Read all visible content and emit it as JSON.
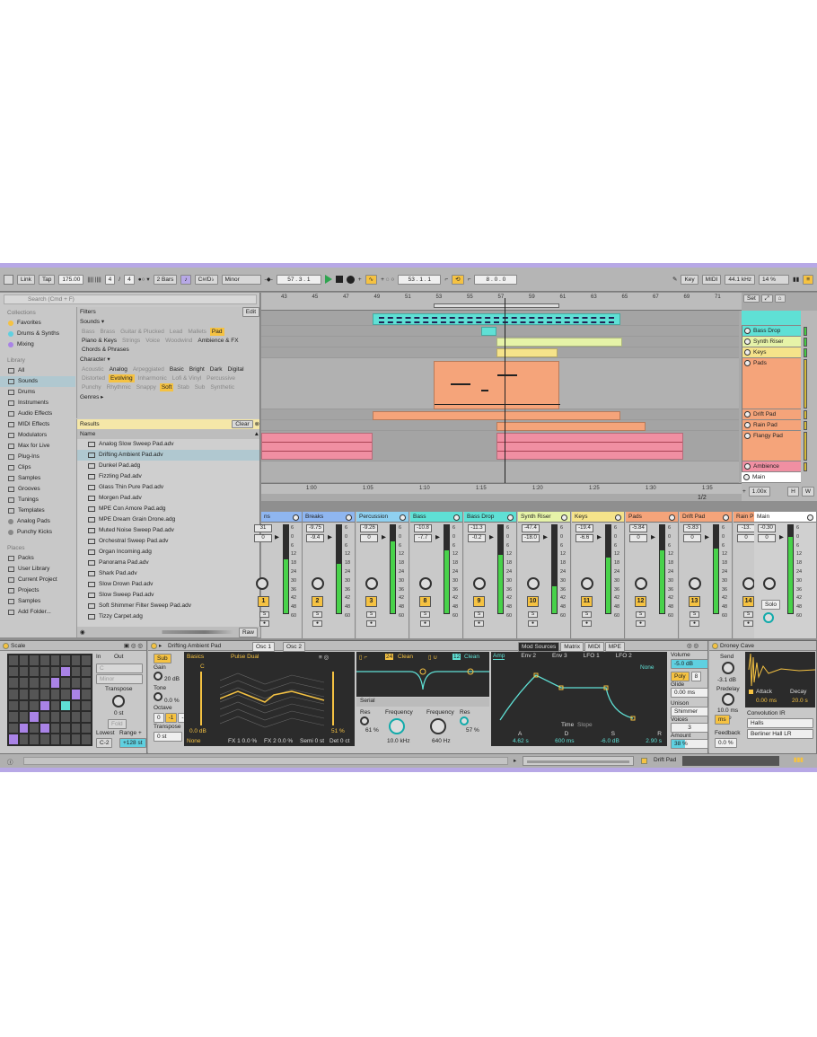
{
  "transport": {
    "link": "Link",
    "tap": "Tap",
    "tempo": "175.00",
    "signature_num": "4",
    "signature_den": "4",
    "quantize": "2 Bars",
    "key": "C#/D♭",
    "scale": "Minor",
    "position": "57 .  3 .  1",
    "loop_start": "53 .  1 .  1",
    "loop_length": "8 .  0 .  0",
    "key_btn": "Key",
    "midi_btn": "MIDI",
    "sample_rate": "44.1 kHz",
    "cpu": "14 %"
  },
  "browser": {
    "search_placeholder": "Search (Cmd + F)",
    "collections_header": "Collections",
    "collections": [
      {
        "label": "Favorites",
        "color": "#f5c242"
      },
      {
        "label": "Drums & Synths",
        "color": "#5fd0e0"
      },
      {
        "label": "Mixing",
        "color": "#a983e6"
      }
    ],
    "library_header": "Library",
    "library": [
      "All",
      "Sounds",
      "Drums",
      "Instruments",
      "Audio Effects",
      "MIDI Effects",
      "Modulators",
      "Max for Live",
      "Plug-Ins",
      "Clips",
      "Samples",
      "Grooves",
      "Tunings",
      "Templates",
      "Analog Pads",
      "Punchy Kicks"
    ],
    "places_header": "Places",
    "places": [
      "Packs",
      "User Library",
      "Current Project",
      "Projects",
      "Samples",
      "Add Folder..."
    ],
    "filters_label": "Filters",
    "edit": "Edit",
    "sounds_label": "Sounds ▾",
    "sounds_tags": [
      "Bass",
      "Brass",
      "Guitar & Plucked",
      "Lead",
      "Mallets",
      "Pad",
      "Piano & Keys",
      "Strings",
      "Voice",
      "Woodwind",
      "Ambience & FX",
      "Chords & Phrases"
    ],
    "character_label": "Character ▾",
    "character_tags": [
      "Acoustic",
      "Analog",
      "Arpeggiated",
      "Basic",
      "Bright",
      "Dark",
      "Digital",
      "Distorted",
      "Evolving",
      "Inharmonic",
      "Lofi & Vinyl",
      "Percussive",
      "Punchy",
      "Rhythmic",
      "Snappy",
      "Soft",
      "Stab",
      "Sub",
      "Synthetic"
    ],
    "genres_label": "Genres ▸",
    "results_label": "Results",
    "clear": "Clear",
    "name_col": "Name",
    "results": [
      "Analog Slow Sweep Pad.adv",
      "Drifting Ambient Pad.adv",
      "Dunkel Pad.adg",
      "Fizzling Pad.adv",
      "Glass Thin Pure Pad.adv",
      "Morgen Pad.adv",
      "MPE Con Amore Pad.adg",
      "MPE Dream Grain Drone.adg",
      "Muted Noise Sweep Pad.adv",
      "Orchestral Sweep Pad.adv",
      "Organ Incoming.adg",
      "Panorama Pad.adv",
      "Shark Pad.adv",
      "Slow Drown Pad.adv",
      "Slow Sweep Pad.adv",
      "Soft Shimmer Filter Sweep Pad.adv",
      "Tizzy Carpet.adg"
    ],
    "raw": "Raw"
  },
  "arrangement": {
    "bars": [
      "43",
      "45",
      "47",
      "49",
      "51",
      "53",
      "55",
      "57",
      "59",
      "61",
      "63",
      "65",
      "67",
      "69",
      "71"
    ],
    "times": [
      "1:00",
      "1:05",
      "1:10",
      "1:15",
      "1:20",
      "1:25",
      "1:30",
      "1:35"
    ],
    "set": "Set",
    "zoom": "1.00x",
    "fraction": "1/2",
    "h": "H",
    "w": "W",
    "tracks": [
      {
        "name": "Bass Drop",
        "color": "#5fe0d5"
      },
      {
        "name": "Synth Riser",
        "color": "#e6f3a8"
      },
      {
        "name": "Keys",
        "color": "#f5e38a"
      },
      {
        "name": "Pads",
        "color": "#f5a47a"
      },
      {
        "name": "Drift Pad",
        "color": "#f5a47a"
      },
      {
        "name": "Rain Pad",
        "color": "#f5a47a"
      },
      {
        "name": "Flangy Pad",
        "color": "#f5a47a"
      },
      {
        "name": "Ambience",
        "color": "#f08fa2"
      },
      {
        "name": "Main",
        "color": "#ffffff"
      }
    ]
  },
  "mixer": [
    {
      "name": "ns",
      "color": "#8fb6f0",
      "vol": "31",
      "pan": "0",
      "num": "1"
    },
    {
      "name": "Breaks",
      "color": "#8fb6f0",
      "vol": "-9.75",
      "pan": "-9.4",
      "num": "2"
    },
    {
      "name": "Percussion",
      "color": "#8fd0f0",
      "vol": "-9.26",
      "pan": "0",
      "num": "3"
    },
    {
      "name": "Bass",
      "color": "#5fe0d5",
      "vol": "-10.8",
      "pan": "-7.7",
      "num": "8"
    },
    {
      "name": "Bass Drop",
      "color": "#5fe0d5",
      "vol": "-11.3",
      "pan": "-0.2",
      "num": "9"
    },
    {
      "name": "Synth Riser",
      "color": "#e6f3a8",
      "vol": "-47.4",
      "pan": "-18.0",
      "num": "10"
    },
    {
      "name": "Keys",
      "color": "#f5e38a",
      "vol": "-19.4",
      "pan": "-6.6",
      "num": "11"
    },
    {
      "name": "Pads",
      "color": "#f5a47a",
      "vol": "-5.84",
      "pan": "0",
      "num": "12"
    },
    {
      "name": "Drift Pad",
      "color": "#f5a47a",
      "vol": "-5.83",
      "pan": "0",
      "num": "13"
    },
    {
      "name": "Rain P",
      "color": "#f5a47a",
      "vol": "-13.",
      "pan": "0",
      "num": "14"
    },
    {
      "name": "Main",
      "color": "#ffffff",
      "vol": "-0.30",
      "pan": "0",
      "num": ""
    }
  ],
  "mixer_scale": [
    "6",
    "0",
    "6",
    "12",
    "18",
    "24",
    "30",
    "36",
    "42",
    "48",
    "60"
  ],
  "mixer_solo": "Solo",
  "scale_device": {
    "title": "Scale",
    "in": "In",
    "out": "Out",
    "root_placeholder": "C",
    "mode_placeholder": "Minor",
    "transpose_label": "Transpose",
    "transpose": "0 st",
    "fold": "Fold",
    "lowest_label": "Lowest",
    "range_label": "Range +",
    "lowest": "C-2",
    "range": "+128 st"
  },
  "drift": {
    "title": "Drifting Ambient Pad",
    "osc1": "Osc 1",
    "osc2": "Osc 2",
    "sub": "Sub",
    "gain_label": "Gain",
    "gain": "20 dB",
    "tone_label": "Tone",
    "tone": "0.0 %",
    "octave_label": "Octave",
    "octaves": [
      "0",
      "-1",
      "-2"
    ],
    "transpose_label": "Transpose",
    "transpose": "0 st",
    "basics": "Basics",
    "wave": "Pulse Dual",
    "c": "C",
    "db": "0.0 dB",
    "pct": "51 %",
    "none": "None",
    "fx1": "FX 1  0.0 %",
    "fx2": "FX 2  0.0 %",
    "semi": "Semi  0 st",
    "det": "Det  0 ct",
    "filter1_mode": "24",
    "filter1_type": "Clean",
    "filter2_mode": "12",
    "filter2_type": "Clean",
    "serial": "Serial",
    "res_label": "Res",
    "res": "61 %",
    "freq_label": "Frequency",
    "freq": "10.0 kHz",
    "freq2_label": "Frequency",
    "freq2": "640 Hz",
    "res2_label": "Res",
    "res2": "57 %",
    "mod_tabs": [
      "Mod Sources",
      "Matrix",
      "MIDI",
      "MPE"
    ],
    "env_tabs": [
      "Amp",
      "Env 2",
      "Env 3",
      "LFO 1",
      "LFO 2"
    ],
    "env_none": "None",
    "time_label": "Time",
    "slope_label": "Slope",
    "adsr_labels": [
      "A",
      "D",
      "S",
      "R"
    ],
    "adsr": [
      "4.62 s",
      "600 ms",
      "-6.0 dB",
      "2.90 s"
    ],
    "volume_label": "Volume",
    "volume": "-5.0 dB",
    "poly": "Poly",
    "voices_n": "8",
    "glide_label": "Glide",
    "glide": "0.00 ms",
    "unison_label": "Unison",
    "unison": "Shimmer",
    "voices_label": "Voices",
    "voices": "3",
    "amount_label": "Amount",
    "amount": "38 %"
  },
  "droney": {
    "title": "Droney Cave",
    "send_label": "Send",
    "send": "-3.1 dB",
    "predelay_label": "Predelay",
    "predelay": "10.0 ms",
    "ms": "ms",
    "attack_label": "Attack",
    "decay_label": "Decay",
    "attack": "0.00 ms",
    "decay": "20.0 s",
    "conv_label": "Convolution IR",
    "ir_category": "Halls",
    "feedback_label": "Feedback",
    "feedback": "0.0 %",
    "ir": "Berliner Hall LR"
  },
  "status": {
    "clip": "Drift Pad"
  }
}
